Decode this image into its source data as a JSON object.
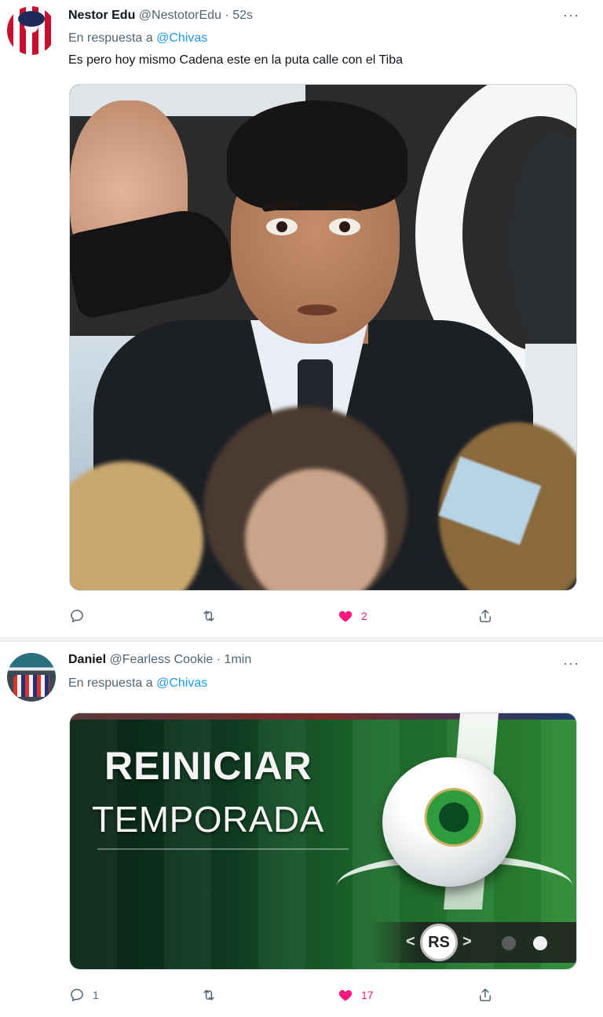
{
  "colors": {
    "accent": "#1d9bf0",
    "like": "#f91880",
    "muted": "#536471",
    "text": "#0f1419"
  },
  "tweets": [
    {
      "name": "Nestor Edu",
      "handle": "@NestotorEdu",
      "separator": "·",
      "time": "52s",
      "reply_prefix": "En respuesta a",
      "reply_mention": "@Chivas",
      "text": "Es pero hoy mismo Cadena este en la puta calle con el Tiba",
      "media": "photo",
      "actions": {
        "reply": "",
        "retweet": "",
        "like": "2",
        "share": ""
      },
      "more": "···"
    },
    {
      "name": "Daniel",
      "handle": "@Fearless Cookie",
      "separator": "·",
      "time": "1min",
      "reply_prefix": "En respuesta a",
      "reply_mention": "@Chivas",
      "media": "image",
      "media_text": {
        "line1": "REINICIAR",
        "line2": "TEMPORADA",
        "badge": "RS",
        "arrow_left": "<",
        "arrow_right": ">"
      },
      "actions": {
        "reply": "1",
        "retweet": "",
        "like": "17",
        "share": ""
      },
      "more": "···"
    }
  ],
  "icons": {
    "reply": "reply-icon",
    "retweet": "retweet-icon",
    "like": "heart-icon",
    "share": "share-icon",
    "more": "more-icon"
  }
}
